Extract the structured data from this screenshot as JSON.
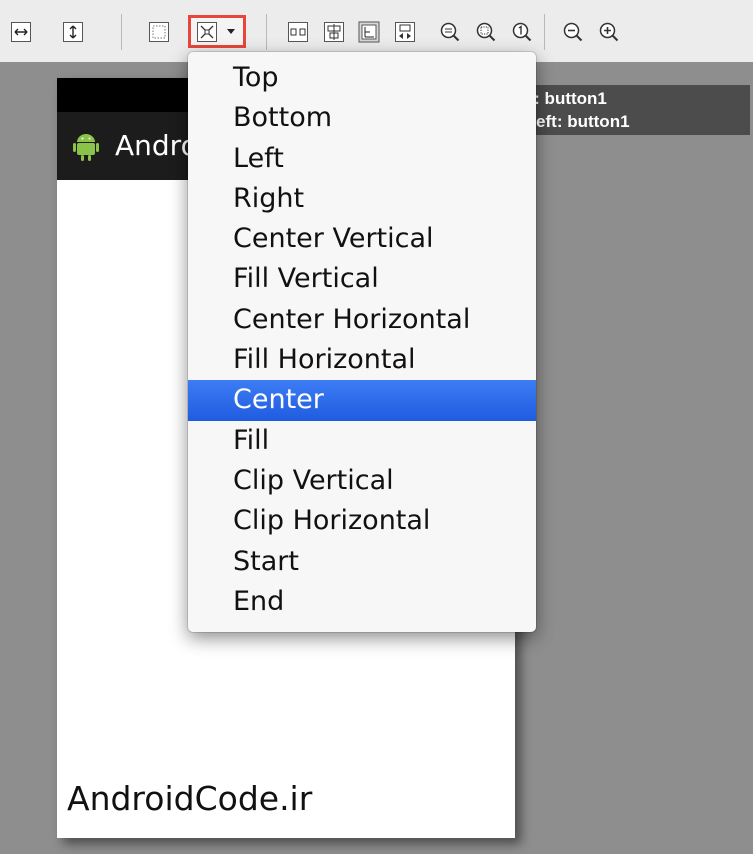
{
  "toolbar": {
    "buttons": [
      {
        "name": "fill-width-icon"
      },
      {
        "name": "fill-height-icon"
      },
      {
        "name": "layout-margins-icon"
      },
      {
        "name": "gravity-icon",
        "has_dropdown": true,
        "highlight_color": "#e8463a"
      },
      {
        "name": "distribute-weights-icon"
      },
      {
        "name": "center-align-icon"
      },
      {
        "name": "align-baseline-icon"
      },
      {
        "name": "clear-weights-icon"
      },
      {
        "name": "zoom-fit-icon"
      },
      {
        "name": "zoom-actual-icon"
      },
      {
        "name": "zoom-100-icon"
      },
      {
        "name": "zoom-out-icon"
      },
      {
        "name": "zoom-in-icon"
      }
    ]
  },
  "device": {
    "app_title": "AndroidCode.ir",
    "footer_text": "AndroidCode.ir"
  },
  "tooltip": {
    "line1": "below: button1",
    "line2": "alignLeft: button1"
  },
  "gravity_menu": {
    "items": [
      "Top",
      "Bottom",
      "Left",
      "Right",
      "Center Vertical",
      "Fill Vertical",
      "Center Horizontal",
      "Fill Horizontal",
      "Center",
      "Fill",
      "Clip Vertical",
      "Clip Horizontal",
      "Start",
      "End"
    ],
    "selected": "Center",
    "selected_color": "#2a67e8"
  }
}
